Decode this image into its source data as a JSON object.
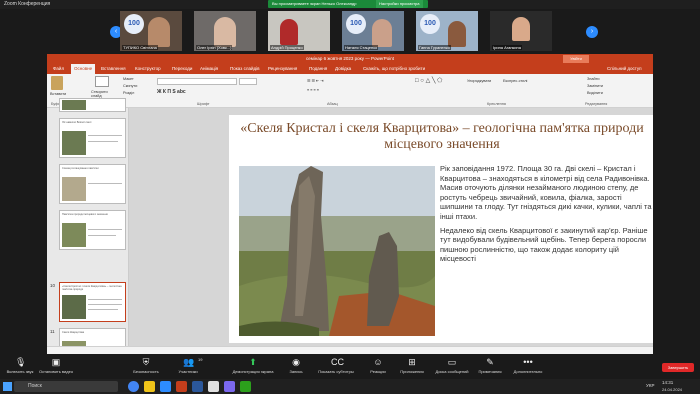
{
  "zoom": {
    "window_title": "Zoom Конференция",
    "share_banner": "Вы просматриваете экран Ненько Олександр",
    "share_settings": "Настройки просмотра",
    "participants": [
      {
        "name": "ТУПИКО Світлана"
      },
      {
        "name": "Олег Ірхін (Ховк...)"
      },
      {
        "name": "Андрій Проценко"
      },
      {
        "name": "Наталя Стаценко"
      },
      {
        "name": "Ганна Гураненко"
      },
      {
        "name": "Ірина Агапкина"
      }
    ],
    "toolbar": {
      "mute": "Включить звук",
      "video": "Остановить видео",
      "security": "Безопасность",
      "participants": "Участники",
      "participants_count": "19",
      "share": "Демонстрация экрана",
      "record": "Запись",
      "captions": "Показать субтитры",
      "reactions": "Реакции",
      "apps": "Приложения",
      "whiteboard": "Доска сообщений",
      "notes": "Примечания",
      "more": "Дополнительно",
      "end": "Завершить"
    }
  },
  "powerpoint": {
    "window_title": "семінар 6 жовтня 2023 року — PowerPoint",
    "menu": [
      "Файл",
      "Основне",
      "Вставлення",
      "Конструктор",
      "Переходи",
      "Анімація",
      "Показ слайдів",
      "Рецензування",
      "Подання",
      "Довідка",
      "Скажіть, що потрібно зробити"
    ],
    "active_tab": "Основне",
    "share_label": "Спільний доступ",
    "ribbon_groups": [
      "Буфер обміну",
      "Слайди",
      "Шрифт",
      "Абзац",
      "Креслення",
      "Редагування"
    ],
    "ribbon_buttons": {
      "paste": "Вставити",
      "new_slide": "Створити слайд",
      "layout": "Макет",
      "reset": "Скинути",
      "section": "Розділ",
      "arrange": "Упорядкувати",
      "quick_styles": "Експрес-стилі",
      "find": "Знайти",
      "replace": "Замінити",
      "select": "Виділити"
    },
    "thumbnails": [
      {
        "num": "",
        "title": ""
      },
      {
        "num": "",
        "title": "Ліс навколо Вовчої скелі"
      },
      {
        "num": "",
        "title": "Схема розташування пам'ятки"
      },
      {
        "num": "",
        "title": "Пам'ятка природи місцевого значення"
      },
      {
        "num": "10",
        "title": "«Скеля Кристал і скеля Кварцитова» – геологічна пам'ятка природи"
      },
      {
        "num": "11",
        "title": "Скеля Кварцитова"
      },
      {
        "num": "12",
        "title": "Пам'ятка природи"
      }
    ],
    "slide": {
      "title": "«Скеля Кристал і скеля Кварцитова» – геологічна пам'ятка природи місцевого значення",
      "paragraph1": "Рік заповідання 1972. Площа 30 га. Дві скелі – Кристал і Кварцитова – знаходяться в кілометрі від села Радивонівка. Масив оточують ділянки незайманого людиною степу, де ростуть чебрець звичайний, ковила, фіалка, зарості шипшини та глоду. Тут гніздяться дикі качки, кулики, чаплі та інші птахи.",
      "paragraph2": "Недалеко від скель Кварцитової є закинутий кар'єр. Раніше тут видобували будівельний щебінь. Тепер берега поросли пишною рослинністю, що також додає колориту цій місцевості"
    }
  },
  "taskbar": {
    "search": "Поиск",
    "time": "14:31",
    "date": "24.04.2024",
    "lang": "УКР"
  }
}
